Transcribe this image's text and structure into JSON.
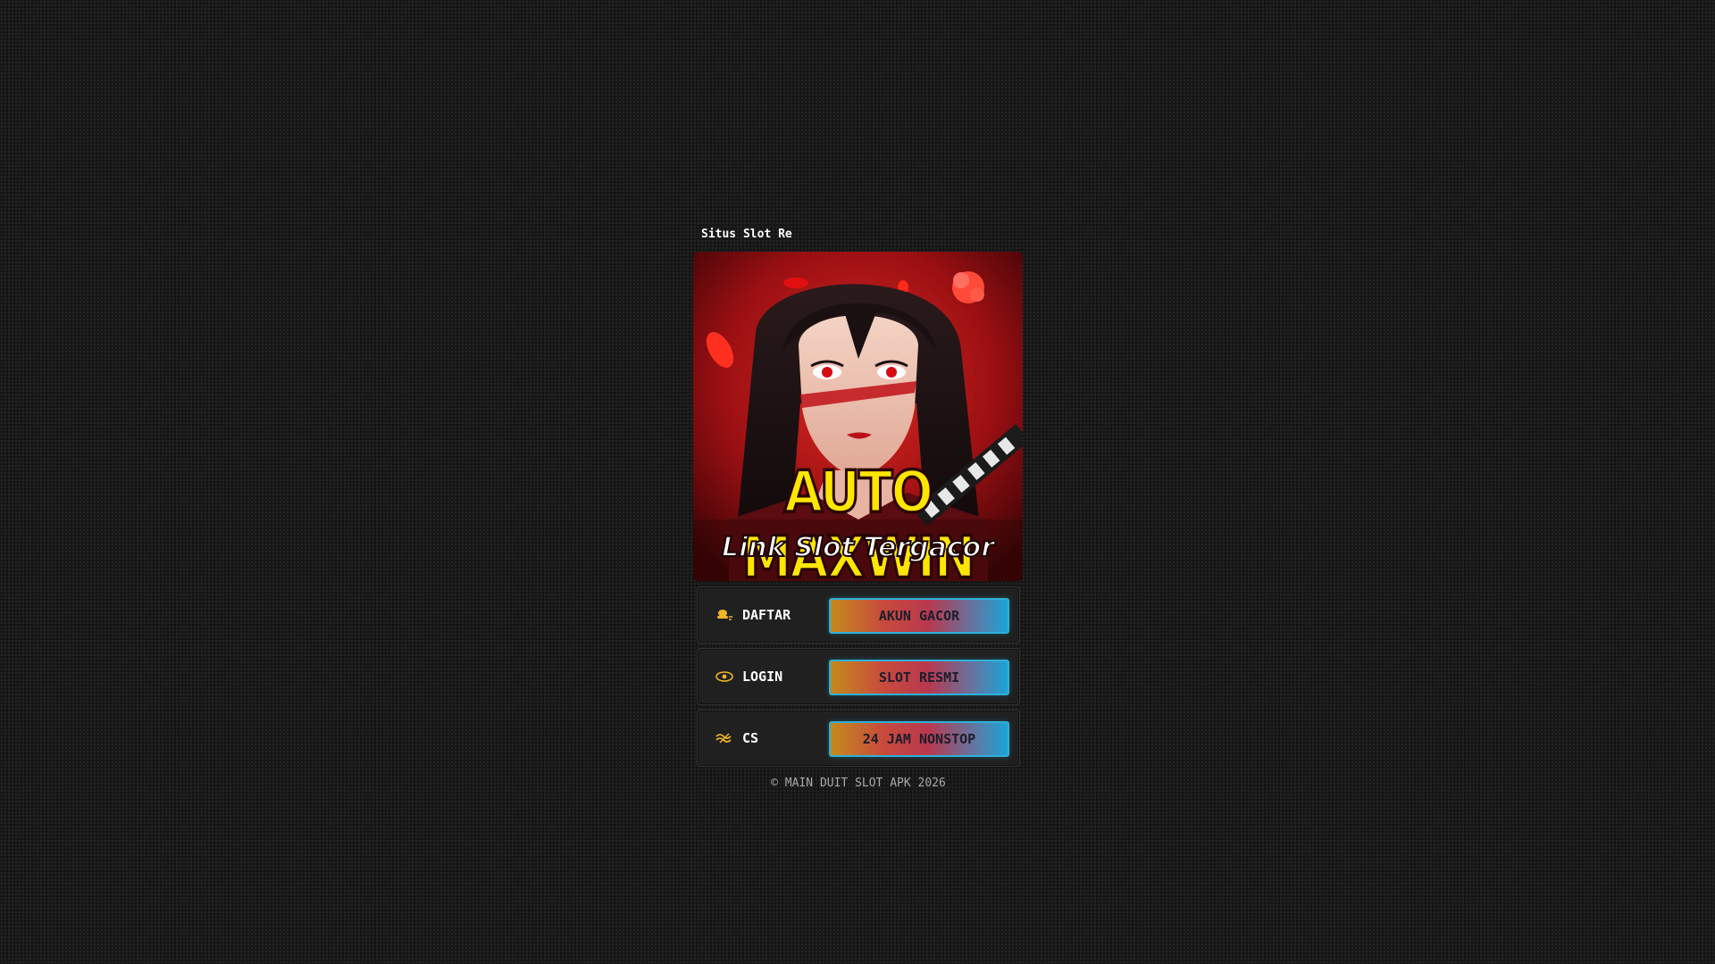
{
  "marquee": {
    "text": "Situs Slot Re"
  },
  "banner": {
    "headline": "AUTO MAXWIN",
    "subline": "Link Slot Tergacor",
    "colors": {
      "background": "#c0151a",
      "headline_fill": "#ffe600",
      "outline": "#2a0505"
    }
  },
  "rows": [
    {
      "label": "DAFTAR",
      "button": "AKUN GACOR",
      "icon": "user-hat-icon"
    },
    {
      "label": "LOGIN",
      "button": "SLOT RESMI",
      "icon": "eye-icon"
    },
    {
      "label": "CS",
      "button": "24 JAM NONSTOP",
      "icon": "chat-wave-icon"
    }
  ],
  "footer": {
    "text": "© MAIN DUIT SLOT APK 2026"
  },
  "colors": {
    "page_bg": "#161616",
    "row_bg": "#202020",
    "button_border": "#2fb0d8",
    "icon_color": "#f0b429"
  }
}
